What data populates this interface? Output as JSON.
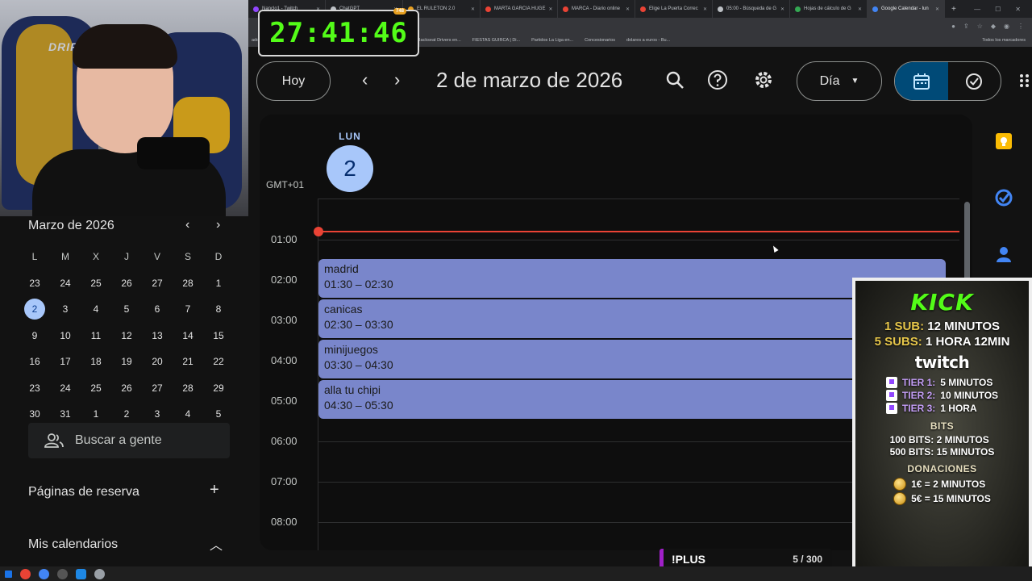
{
  "browser": {
    "tabs": [
      {
        "label": "Nanclo1 - Twitch",
        "color": "#9146ff"
      },
      {
        "label": "ChatGPT",
        "color": "#bdc1c6"
      },
      {
        "label": "EL RULETON 2.0",
        "color": "#e8a020"
      },
      {
        "label": "MARTA GARCIA HUGE",
        "color": "#ea4335"
      },
      {
        "label": "MARCA - Diario online",
        "color": "#ea4335"
      },
      {
        "label": "Elige La Puerta Correc",
        "color": "#ea4335"
      },
      {
        "label": "05:00 - Búsqueda de G",
        "color": "#bdc1c6"
      },
      {
        "label": "Hojas de cálculo de G",
        "color": "#34a853"
      },
      {
        "label": "Google Calendar - lun",
        "color": "#4285f4"
      }
    ],
    "bookmarks": [
      "ado",
      "Estado del servicio...",
      "Razer Mouse Grip T...",
      "alangulotv.blog",
      "Backseat Drivers en...",
      "FIESTAS GUIRCA | Di...",
      "Partidos La Liga en...",
      "Concesionarios",
      "dolares a euros - Bu..."
    ],
    "bookmarks_end": "Todos los marcadores"
  },
  "timer": {
    "value": "27:41:46",
    "badge": "748"
  },
  "webcam": {
    "chair_brand": "DRIF"
  },
  "mini_calendar": {
    "title": "Marzo de 2026",
    "weekdays": [
      "L",
      "M",
      "X",
      "J",
      "V",
      "S",
      "D"
    ],
    "weeks": [
      [
        "23",
        "24",
        "25",
        "26",
        "27",
        "28",
        "1"
      ],
      [
        "2",
        "3",
        "4",
        "5",
        "6",
        "7",
        "8"
      ],
      [
        "9",
        "10",
        "11",
        "12",
        "13",
        "14",
        "15"
      ],
      [
        "16",
        "17",
        "18",
        "19",
        "20",
        "21",
        "22"
      ],
      [
        "23",
        "24",
        "25",
        "26",
        "27",
        "28",
        "29"
      ],
      [
        "30",
        "31",
        "1",
        "2",
        "3",
        "4",
        "5"
      ]
    ],
    "selected": "2"
  },
  "left_panel": {
    "search_people": "Buscar a gente",
    "booking_pages": "Páginas de reserva",
    "my_calendars": "Mis calendarios"
  },
  "toolbar": {
    "today": "Hoy",
    "date_title": "2 de marzo de 2026",
    "view": "Día"
  },
  "day_view": {
    "weekday": "LUN",
    "day_number": "2",
    "timezone": "GMT+01",
    "hours": [
      "01:00",
      "02:00",
      "03:00",
      "04:00",
      "05:00",
      "06:00",
      "07:00",
      "08:00"
    ],
    "events": [
      {
        "title": "madrid",
        "time": "01:30 – 02:30"
      },
      {
        "title": "canicas",
        "time": "02:30 – 03:30"
      },
      {
        "title": "minijuegos",
        "time": "03:30 – 04:30"
      },
      {
        "title": "alla tu chipi",
        "time": "04:30 – 05:30"
      }
    ],
    "event_color": "#7986cb",
    "now_line_color": "#ea4335"
  },
  "kick_overlay": {
    "logo": "KICK",
    "sub1_label": "1 SUB:",
    "sub1_value": "12 MINUTOS",
    "sub5_label": "5 SUBS:",
    "sub5_value": "1 HORA 12MIN",
    "twitch_logo": "twitch",
    "tiers": [
      {
        "label": "TIER 1:",
        "value": "5 MINUTOS"
      },
      {
        "label": "TIER 2:",
        "value": "10 MINUTOS"
      },
      {
        "label": "TIER 3:",
        "value": "1 HORA"
      }
    ],
    "bits_heading": "BITS",
    "bits": [
      "100 BITS: 2 MINUTOS",
      "500 BITS: 15 MINUTOS"
    ],
    "donations_heading": "DONACIONES",
    "donations": [
      "1€ = 2 MINUTOS",
      "5€ = 15 MINUTOS"
    ]
  },
  "plus_bar": {
    "label": "!PLUS",
    "count": "5 / 300"
  }
}
